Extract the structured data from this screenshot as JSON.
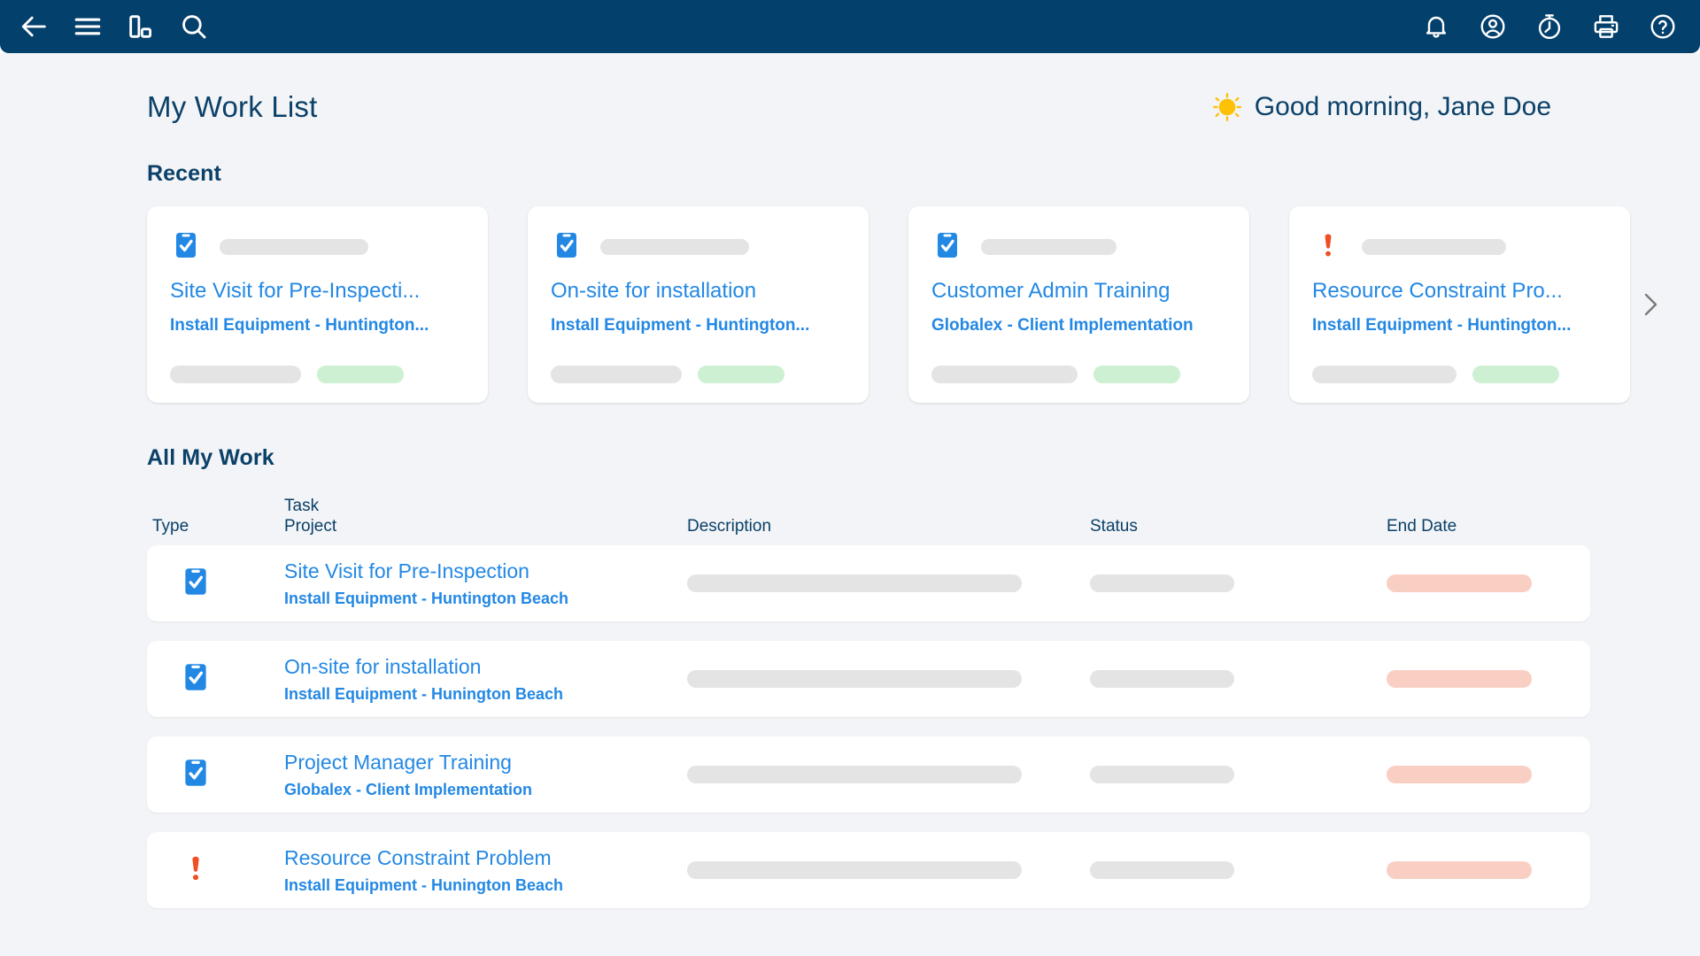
{
  "appbar": {
    "background": "#04406C",
    "left_icons": [
      {
        "name": "back-arrow-icon",
        "label": "Back"
      },
      {
        "name": "hamburger-menu-icon",
        "label": "Menu"
      },
      {
        "name": "bar-chart-icon",
        "label": "Reports"
      },
      {
        "name": "search-icon",
        "label": "Search"
      }
    ],
    "right_icons": [
      {
        "name": "bell-icon",
        "label": "Notifications"
      },
      {
        "name": "user-account-icon",
        "label": "Account"
      },
      {
        "name": "timer-icon",
        "label": "Timer"
      },
      {
        "name": "printer-icon",
        "label": "Print"
      },
      {
        "name": "help-icon",
        "label": "Help"
      }
    ]
  },
  "header": {
    "page_title": "My Work List",
    "greeting": "Good morning, Jane Doe",
    "greeting_icon": "sun-icon",
    "title_color": "#0B4068",
    "sun_color": "#FFC107"
  },
  "recent": {
    "section_title": "Recent",
    "next_arrow_icon": "chevron-right-icon",
    "cards": [
      {
        "icon": "clipboard-check-icon",
        "icon_type": "task",
        "title": "Site Visit for Pre-Inspecti...",
        "project": "Install Equipment - Huntington..."
      },
      {
        "icon": "clipboard-check-icon",
        "icon_type": "task",
        "title": "On-site for installation",
        "project": "Install Equipment - Huntington..."
      },
      {
        "icon": "clipboard-check-icon",
        "icon_type": "task",
        "title": "Customer Admin Training",
        "project": "Globalex - Client Implementation"
      },
      {
        "icon": "exclamation-icon",
        "icon_type": "issue",
        "title": "Resource Constraint Pro...",
        "project": "Install Equipment - Huntington..."
      }
    ]
  },
  "all_my_work": {
    "section_title": "All My Work",
    "columns": {
      "type": "Type",
      "task": "Task",
      "project": "Project",
      "description": "Description",
      "status": "Status",
      "end_date": "End Date"
    },
    "rows": [
      {
        "icon": "clipboard-check-icon",
        "icon_type": "task",
        "task": "Site Visit for Pre-Inspection",
        "project": "Install Equipment - Huntington Beach"
      },
      {
        "icon": "clipboard-check-icon",
        "icon_type": "task",
        "task": "On-site for installation",
        "project": "Install Equipment - Hunington Beach"
      },
      {
        "icon": "clipboard-check-icon",
        "icon_type": "task",
        "task": "Project Manager Training",
        "project": "Globalex - Client Implementation"
      },
      {
        "icon": "exclamation-icon",
        "icon_type": "issue",
        "task": "Resource Constraint Problem",
        "project": "Install Equipment - Hunington Beach"
      }
    ]
  },
  "colors": {
    "navy": "#04406C",
    "link_blue": "#2388E4",
    "icon_blue": "#2388E4",
    "issue_red": "#F04E23",
    "page_bg": "#F2F4F7",
    "skeleton_gray": "#E4E4E4",
    "skeleton_green": "#CCF0D1",
    "skeleton_pink": "#F9CFC4"
  }
}
